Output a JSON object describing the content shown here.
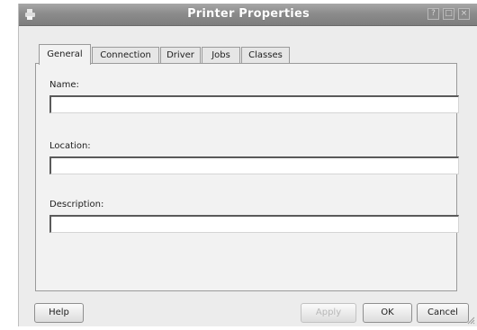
{
  "window": {
    "title": "Printer Properties",
    "help_glyph": "?",
    "maximize_glyph": "□",
    "close_glyph": "×"
  },
  "tabs": [
    {
      "label": "General",
      "active": true
    },
    {
      "label": "Connection",
      "active": false
    },
    {
      "label": "Driver",
      "active": false
    },
    {
      "label": "Jobs",
      "active": false
    },
    {
      "label": "Classes",
      "active": false
    }
  ],
  "form": {
    "name_label": "Name:",
    "name_value": "",
    "location_label": "Location:",
    "location_value": "",
    "description_label": "Description:",
    "description_value": ""
  },
  "buttons": {
    "help": "Help",
    "apply": "Apply",
    "ok": "OK",
    "cancel": "Cancel"
  }
}
